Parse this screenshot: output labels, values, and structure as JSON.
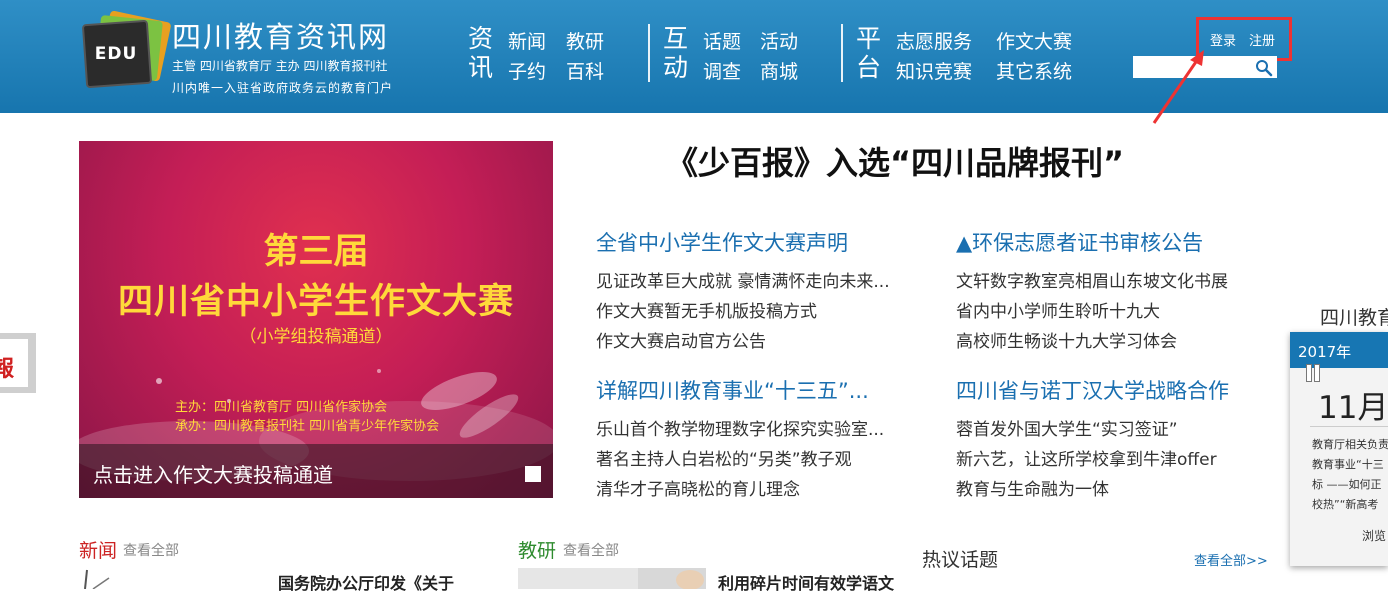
{
  "header": {
    "logo_text": "EDU",
    "site_title": "四川教育资讯网",
    "site_sub1": "主管  四川省教育厅  主办  四川教育报刊社",
    "site_sub2": "川内唯一入驻省政府政务云的教育门户",
    "nav": [
      {
        "category": [
          "资",
          "讯"
        ],
        "links": [
          "新闻",
          "教研",
          "子约",
          "百科"
        ]
      },
      {
        "category": [
          "互",
          "动"
        ],
        "links": [
          "话题",
          "活动",
          "调查",
          "商城"
        ]
      },
      {
        "category": [
          "平",
          "台"
        ],
        "links": [
          "志愿服务",
          "作文大赛",
          "知识竞赛",
          "其它系统"
        ]
      }
    ],
    "login": "登录",
    "register": "注册",
    "search_placeholder": "",
    "annotation_color": "#ee3333"
  },
  "banner": {
    "line1": "第三届",
    "line2": "四川省中小学生作文大赛",
    "line3": "（小学组投稿通道）",
    "org1": "主办：四川省教育厅  四川省作家协会",
    "org2": "承办：四川教育报刊社  四川省青少年作家协会",
    "caption": "点击进入作文大赛投稿通道"
  },
  "headline": "《少百报》入选“四川品牌报刊”",
  "columns": [
    {
      "title": "全省中小学生作文大赛声明",
      "items": [
        "见证改革巨大成就 豪情满怀走向未来...",
        "作文大赛暂无手机版投稿方式",
        "作文大赛启动官方公告"
      ]
    },
    {
      "title": "▲环保志愿者证书审核公告",
      "items": [
        "文轩数字教室亮相眉山东坡文化书展",
        "省内中小学师生聆听十九大",
        "高校师生畅谈十九大学习体会"
      ]
    },
    {
      "title": "详解四川教育事业“十三五”...",
      "items": [
        "乐山首个教学物理数字化探究实验室...",
        "著名主持人白岩松的“另类”教子观",
        "清华才子高晓松的育儿理念"
      ]
    },
    {
      "title": "四川省与诺丁汉大学战略合作",
      "items": [
        "蓉首发外国大学生“实习签证”",
        "新六艺，让这所学校拿到牛津offer",
        "教育与生命融为一体"
      ]
    }
  ],
  "sections": {
    "news": {
      "title": "新闻",
      "more": "查看全部",
      "first_title": "国务院办公厅印发《关于"
    },
    "research": {
      "title": "教研",
      "more": "查看全部",
      "first_title": "利用碎片时间有效学语文"
    },
    "hot": {
      "title": "热议话题",
      "more": "查看全部>>"
    }
  },
  "sidebar": {
    "title": "四川教育",
    "cal_year": "2017年",
    "cal_month": "11月",
    "cal_lines": [
      "教育厅相关负责",
      "教育事业“十三",
      "标 ——如何正",
      "校热”“新高考"
    ],
    "browse": "浏览",
    "left_float_char": "報"
  },
  "colors": {
    "header_bg": "#1a7cb5",
    "link_blue": "#1a6fb0",
    "news_red": "#cc2222",
    "research_green": "#2e8b2e",
    "banner_yellow": "#ffd93a"
  }
}
